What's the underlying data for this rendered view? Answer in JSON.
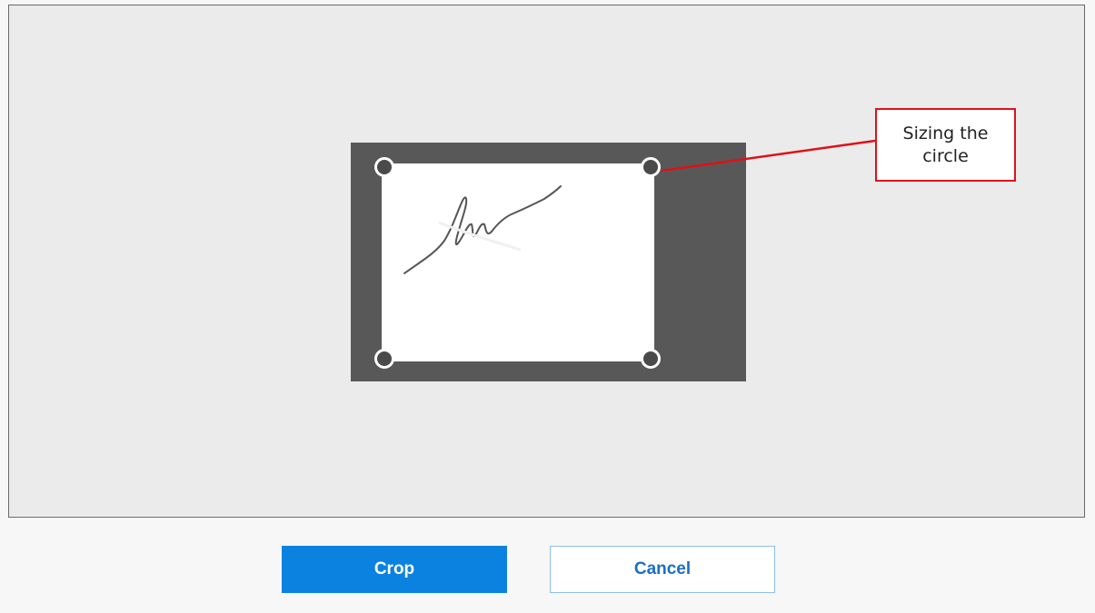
{
  "dialog": {
    "callout_text": "Sizing the circle",
    "crop_label": "Crop",
    "cancel_label": "Cancel"
  },
  "colors": {
    "canvas_bg": "#ebebeb",
    "frame_dark": "#585858",
    "primary_button": "#0c82e0",
    "cancel_text": "#1a6fc4",
    "callout_border": "#e01018"
  },
  "icons": {
    "handles": [
      "resize-handle-icon"
    ],
    "signature": "signature-image"
  }
}
